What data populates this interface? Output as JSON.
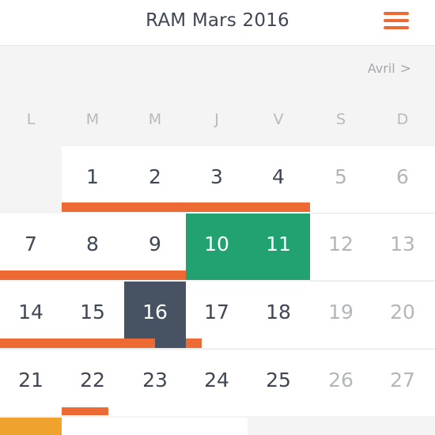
{
  "header": {
    "title": "RAM Mars 2016",
    "menu_icon": "hamburger-menu-icon"
  },
  "nav": {
    "next_label": "Avril",
    "next_icon": "chevron-right-icon"
  },
  "weekdays": [
    "L",
    "M",
    "M",
    "J",
    "V",
    "S",
    "D"
  ],
  "weeks": [
    [
      "",
      "1",
      "2",
      "3",
      "4",
      "5",
      "6"
    ],
    [
      "7",
      "8",
      "9",
      "10",
      "11",
      "12",
      "13"
    ],
    [
      "14",
      "15",
      "16",
      "17",
      "18",
      "19",
      "20"
    ],
    [
      "21",
      "22",
      "23",
      "24",
      "25",
      "26",
      "27"
    ]
  ],
  "highlighted_days": {
    "green": [
      "10",
      "11"
    ],
    "selected": "16"
  },
  "colors": {
    "accent_orange": "#ee6a34",
    "highlight_green": "#22a171",
    "selected_dark": "#475263",
    "event_yellow": "#f0a22e",
    "text_dark": "#3f4754",
    "text_muted": "#b3b6ba"
  }
}
